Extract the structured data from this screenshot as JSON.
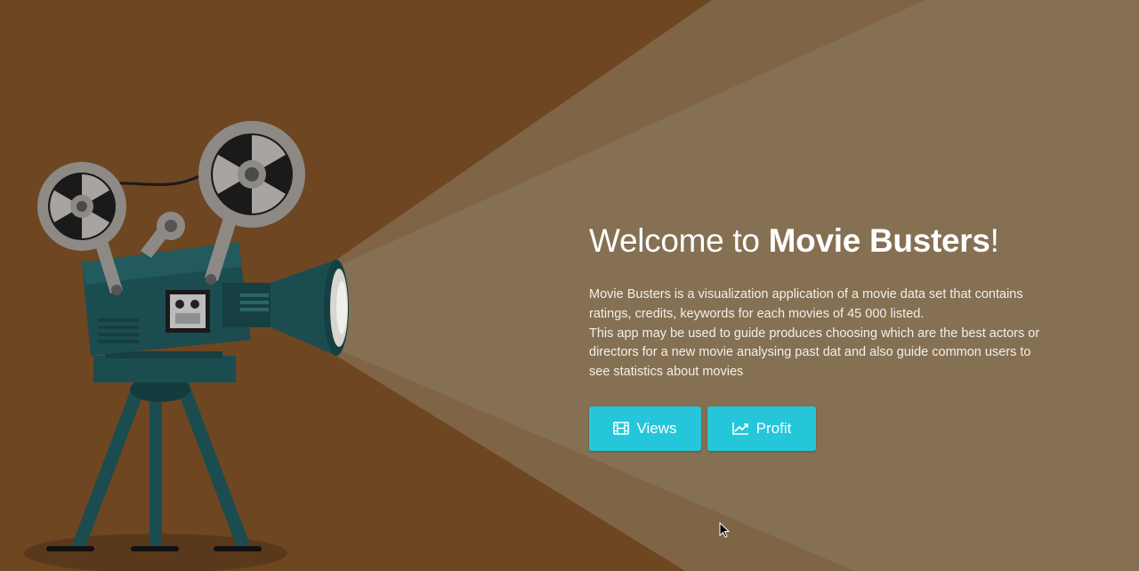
{
  "hero": {
    "title_prefix": "Welcome to ",
    "title_brand": "Movie Busters",
    "title_suffix": "!",
    "description_lines": [
      "Movie Busters is a visualization application of a movie data set that contains ratings, credits, keywords for each movies of 45 000 listed.",
      "This app may be used to guide produces choosing which are the best actors or directors for a new movie analysing past dat and also guide common users to see statistics about movies"
    ]
  },
  "buttons": {
    "views": {
      "label": "Views",
      "icon": "film-icon"
    },
    "profit": {
      "label": "Profit",
      "icon": "line-chart-icon"
    }
  },
  "colors": {
    "background": "#6e4622",
    "light_beam": "#8e7e64",
    "button": "#26c6da",
    "projector_body": "#1b4c50",
    "reel": "#8d8a86"
  }
}
